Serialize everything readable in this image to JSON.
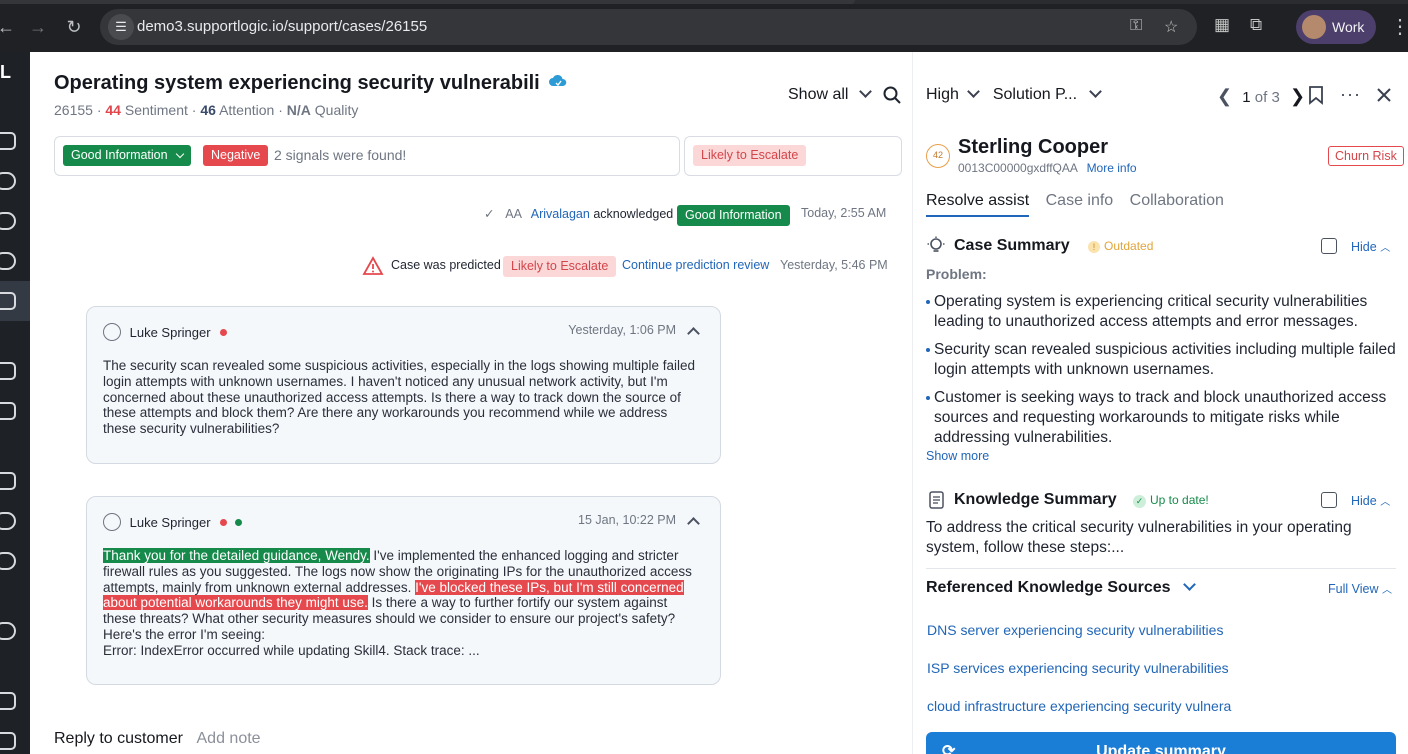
{
  "browser": {
    "url": "demo3.supportlogic.io/support/cases/26155",
    "profile_name": "Work"
  },
  "rail": {
    "logo": "L"
  },
  "case": {
    "title": "Operating system experiencing security vulnerabili",
    "id": "26155",
    "sentiment_value": "44",
    "sentiment_label": "Sentiment",
    "attention_value": "46",
    "attention_label": "Attention",
    "quality_value": "N/A",
    "quality_label": "Quality",
    "sep": "·",
    "show_all": "Show all"
  },
  "signals": {
    "good_info": "Good Information",
    "negative": "Negative",
    "found_text": "2 signals were found!",
    "likely_escalate": "Likely to Escalate"
  },
  "timeline": {
    "ack_initials": "AA",
    "ack_user": "Arivalagan",
    "ack_verb": "acknowledged",
    "ack_tag": "Good Information",
    "ack_time": "Today, 2:55 AM",
    "pred_text": "Case was predicted",
    "pred_tag": "Likely to Escalate",
    "pred_link": "Continue prediction review",
    "pred_time": "Yesterday, 5:46 PM"
  },
  "messages": [
    {
      "author": "Luke Springer",
      "time": "Yesterday, 1:06 PM",
      "body": "The security scan revealed some suspicious activities, especially in the logs showing multiple failed login attempts with unknown usernames. I haven't noticed any unusual network activity, but I'm concerned about these unauthorized access attempts. Is there a way to track down the source of these attempts and block them? Are there any workarounds you recommend while we address these security vulnerabilities?"
    },
    {
      "author": "Luke Springer",
      "time": "15 Jan, 10:22 PM",
      "hl_green": "Thank you for the detailed guidance, Wendy.",
      "part2": " I've implemented the enhanced logging and stricter firewall rules as you suggested. The logs now show the originating IPs for the unauthorized access attempts, mainly from unknown external addresses. ",
      "hl_red": "I've blocked these IPs, but I'm still concerned about potential workarounds they might use.",
      "part4": " Is there a way to further fortify our system against these threats? What other security measures should we consider to ensure our project's safety? Here's the error I'm seeing:",
      "error_line": "Error: IndexError occurred while updating Skill4. Stack trace: ..."
    }
  ],
  "reply": {
    "reply_tab": "Reply to customer",
    "note_tab": "Add note"
  },
  "right_panel": {
    "priority": "High",
    "solution": "Solution P...",
    "page_current": "1",
    "page_of": "of 3",
    "customer_badge": "42",
    "customer_name": "Sterling Cooper",
    "customer_id": "0013C00000gxdffQAA",
    "more_info": "More info",
    "churn": "Churn Risk",
    "tabs": [
      "Resolve assist",
      "Case info",
      "Collaboration"
    ],
    "case_summary": {
      "title": "Case Summary",
      "status": "Outdated",
      "hide": "Hide",
      "problem_label": "Problem:",
      "bullets": [
        "Operating system is experiencing critical security vulnerabilities leading to unauthorized access attempts and error messages.",
        "Security scan revealed suspicious activities including multiple failed login attempts with unknown usernames.",
        "Customer is seeking ways to track and block unauthorized access sources and requesting workarounds to mitigate risks while addressing vulnerabilities."
      ],
      "show_more": "Show more"
    },
    "knowledge_summary": {
      "title": "Knowledge Summary",
      "status": "Up to date!",
      "hide": "Hide",
      "text": "To address the critical security vulnerabilities in your operating system, follow these steps:..."
    },
    "references": {
      "title": "Referenced Knowledge Sources",
      "full_view": "Full View",
      "links": [
        "DNS server experiencing security vulnerabilities",
        "ISP services experiencing security vulnerabilities",
        "cloud infrastructure experiencing security vulnera"
      ]
    },
    "update_button": "Update summary"
  },
  "colors": {
    "brand_blue": "#2166b8",
    "good_green": "#158a4a",
    "negative_red": "#e5484d",
    "escalate_pink": "#fbd7d8"
  }
}
